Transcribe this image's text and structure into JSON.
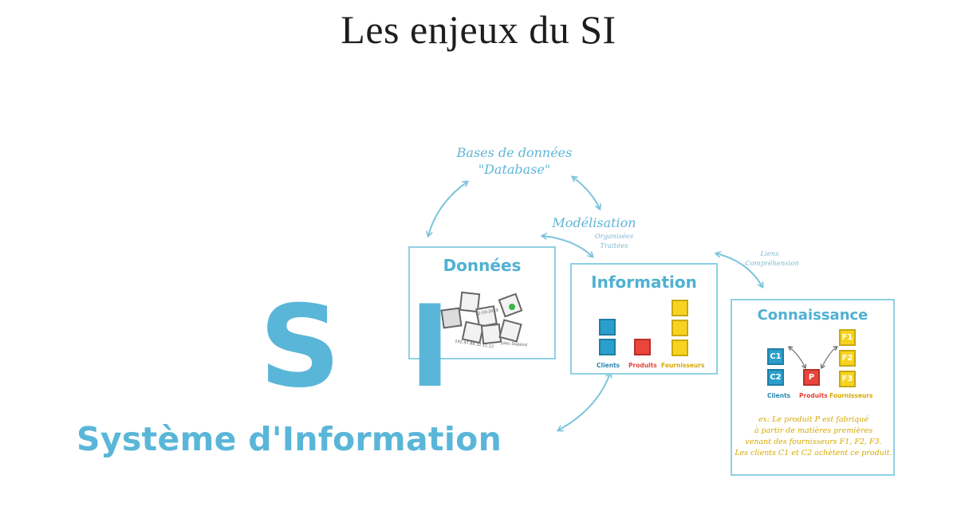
{
  "page": {
    "title": "Les enjeux du SI"
  },
  "hero": {
    "acronym": "S I",
    "subtitle": "Système d'Information"
  },
  "cycle": {
    "database_line1": "Bases de données",
    "database_line2": "\"Database\"",
    "modelisation": "Modélisation",
    "organisees": "Organisées",
    "traitees": "Traitées",
    "liens": "Liens",
    "comprehension": "Compréhension"
  },
  "donnees": {
    "title": "Données",
    "scribbles": [
      "22-10-2019",
      "192.97.88.32.11.12",
      "Jules Dupond"
    ]
  },
  "information": {
    "title": "Information",
    "labels": {
      "clients": "Clients",
      "produits": "Produits",
      "fournisseurs": "Fournisseurs"
    }
  },
  "connaissance": {
    "title": "Connaissance",
    "squares": {
      "c1": "C1",
      "c2": "C2",
      "p": "P",
      "f1": "F1",
      "f2": "F2",
      "f3": "F3"
    },
    "labels": {
      "clients": "Clients",
      "produits": "Produits",
      "fournisseurs": "Fournisseurs"
    },
    "note": [
      "ex: Le produit P est fabriqué",
      "à partir de matières premières",
      "venant des fournisseurs F1, F2, F3.",
      "Les clients C1 et C2 achètent ce produit."
    ]
  },
  "colors": {
    "accent": "#5ab6d8",
    "blue": "#2b9fcc",
    "red": "#e8453c",
    "yellow": "#f7d31f"
  }
}
